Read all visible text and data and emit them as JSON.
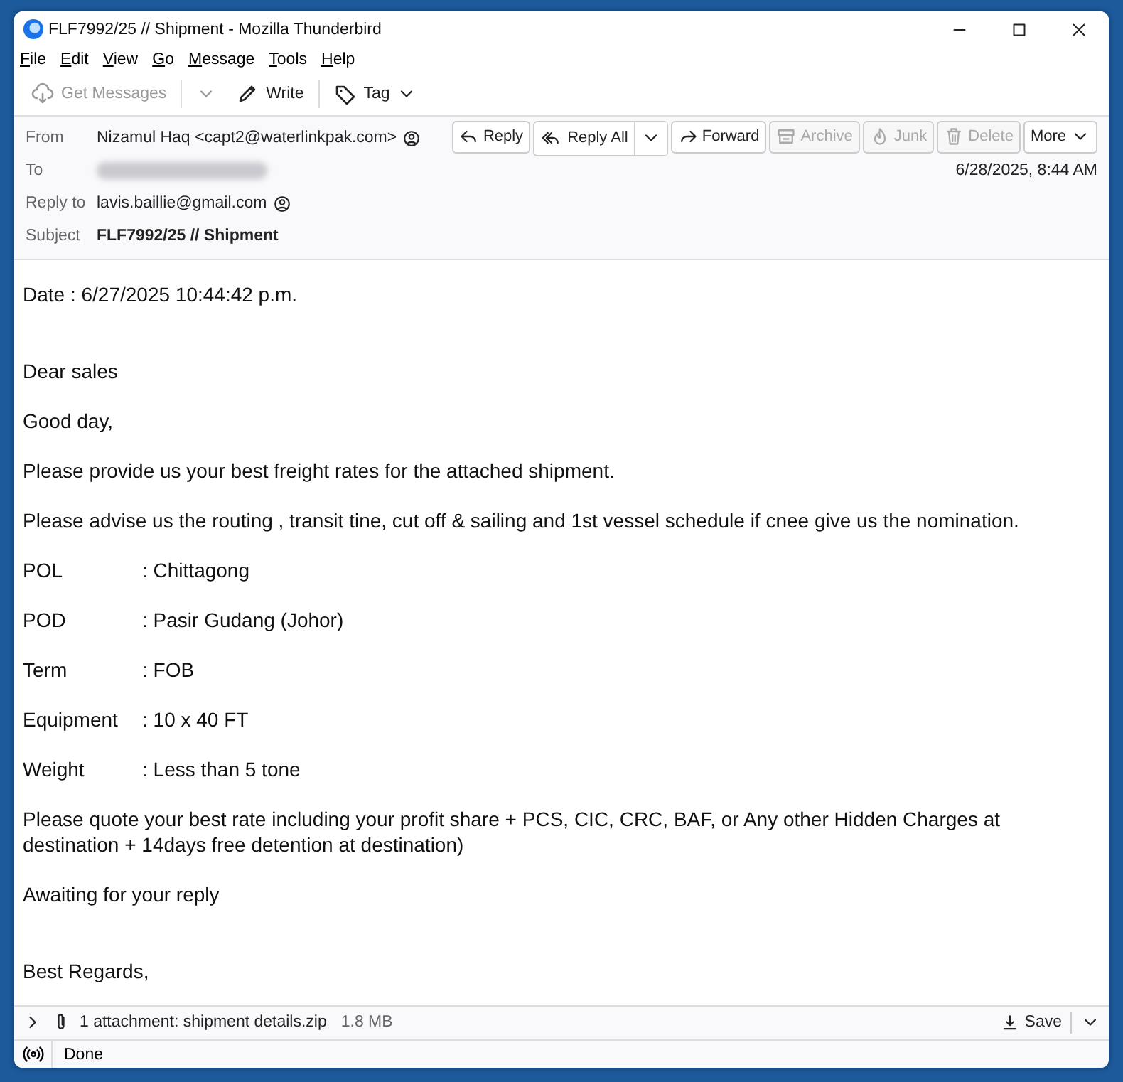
{
  "window": {
    "title": "FLF7992/25 // Shipment - Mozilla Thunderbird"
  },
  "menu": [
    {
      "label": "File"
    },
    {
      "label": "Edit"
    },
    {
      "label": "View"
    },
    {
      "label": "Go"
    },
    {
      "label": "Message"
    },
    {
      "label": "Tools"
    },
    {
      "label": "Help"
    }
  ],
  "toolbar": [
    {
      "kind": "get",
      "label": "Get Messages",
      "disabled": true
    },
    {
      "kind": "write",
      "label": "Write",
      "disabled": false
    },
    {
      "kind": "tag",
      "label": "Tag",
      "disabled": false
    }
  ],
  "header": {
    "from_label": "From",
    "from": "Nizamul Haq <capt2@waterlinkpak.com>",
    "to_label": "To",
    "reply_to_label": "Reply to",
    "reply_to": "lavis.baillie@gmail.com",
    "subject_label": "Subject",
    "subject": "FLF7992/25 // Shipment",
    "date": "6/28/2025, 8:44 AM"
  },
  "actions": [
    {
      "kind": "reply",
      "label": "Reply",
      "disabled": false
    },
    {
      "kind": "replyall",
      "label": "Reply All",
      "disabled": false
    },
    {
      "kind": "forward",
      "label": "Forward",
      "disabled": false
    },
    {
      "kind": "archive",
      "label": "Archive",
      "disabled": true
    },
    {
      "kind": "junk",
      "label": "Junk",
      "disabled": true
    },
    {
      "kind": "delete",
      "label": "Delete",
      "disabled": true
    },
    {
      "kind": "more",
      "label": "More",
      "disabled": false
    }
  ],
  "body": [
    {
      "kind": "text",
      "text": "Date : 6/27/2025 10:44:42 p.m."
    },
    {
      "kind": "blank"
    },
    {
      "kind": "text",
      "text": "Dear sales"
    },
    {
      "kind": "text",
      "text": "Good day,"
    },
    {
      "kind": "text",
      "text": "Please provide us your best freight rates for the attached shipment."
    },
    {
      "kind": "text",
      "text": "Please advise us the routing , transit tine, cut off & sailing and 1st vessel schedule if cnee give us the nomination."
    },
    {
      "kind": "field",
      "label": "POL",
      "value": ": Chittagong"
    },
    {
      "kind": "field",
      "label": "POD",
      "value": ": Pasir Gudang (Johor)"
    },
    {
      "kind": "field",
      "label": "Term",
      "value": ": FOB"
    },
    {
      "kind": "field",
      "label": "Equipment",
      "value": ": 10 x 40 FT"
    },
    {
      "kind": "field",
      "label": "Weight",
      "value": ": Less than 5 tone"
    },
    {
      "kind": "text",
      "text": "Please quote your best rate including your profit share + PCS, CIC, CRC, BAF, or Any other Hidden Charges at destination + 14days free detention at destination)"
    },
    {
      "kind": "text",
      "text": "Awaiting for your reply"
    },
    {
      "kind": "blank"
    },
    {
      "kind": "text",
      "text": "Best Regards,"
    }
  ],
  "attachment": {
    "summary": "1 attachment: shipment details.zip",
    "size": "1.8 MB",
    "save": "Save",
    "expanded": false
  },
  "status_bar": {
    "text": "Done"
  }
}
